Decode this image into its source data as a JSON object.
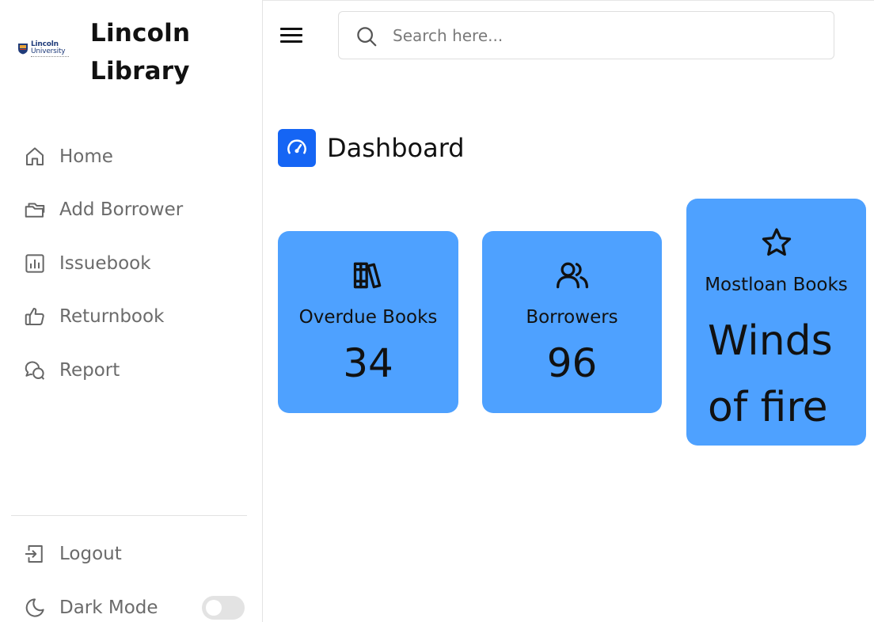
{
  "brand": {
    "logo_text_line1": "Lincoln",
    "logo_text_line2": "University",
    "title": "Lincoln Library"
  },
  "sidebar": {
    "items": [
      {
        "label": "Home",
        "icon": "home-icon"
      },
      {
        "label": "Add Borrower",
        "icon": "folders-icon"
      },
      {
        "label": "Issuebook",
        "icon": "bar-chart-icon"
      },
      {
        "label": "Returnbook",
        "icon": "thumbs-up-icon"
      },
      {
        "label": "Report",
        "icon": "chat-bubbles-icon"
      }
    ],
    "logout": {
      "label": "Logout",
      "icon": "logout-icon"
    },
    "dark_mode": {
      "label": "Dark Mode",
      "icon": "moon-icon",
      "enabled": false
    }
  },
  "header": {
    "menu_icon": "hamburger-menu-icon",
    "search": {
      "placeholder": "Search here...",
      "value": "",
      "icon": "search-icon"
    }
  },
  "dashboard": {
    "title": "Dashboard",
    "icon": "speedometer-icon",
    "accent_color": "#1565f4",
    "card_color": "#4ea1ff",
    "cards": [
      {
        "title": "Overdue Books",
        "value": "34",
        "icon": "books-icon"
      },
      {
        "title": "Borrowers",
        "value": "96",
        "icon": "users-icon"
      },
      {
        "title": "Mostloan Books",
        "value": "Winds of fire",
        "icon": "star-icon"
      }
    ]
  }
}
